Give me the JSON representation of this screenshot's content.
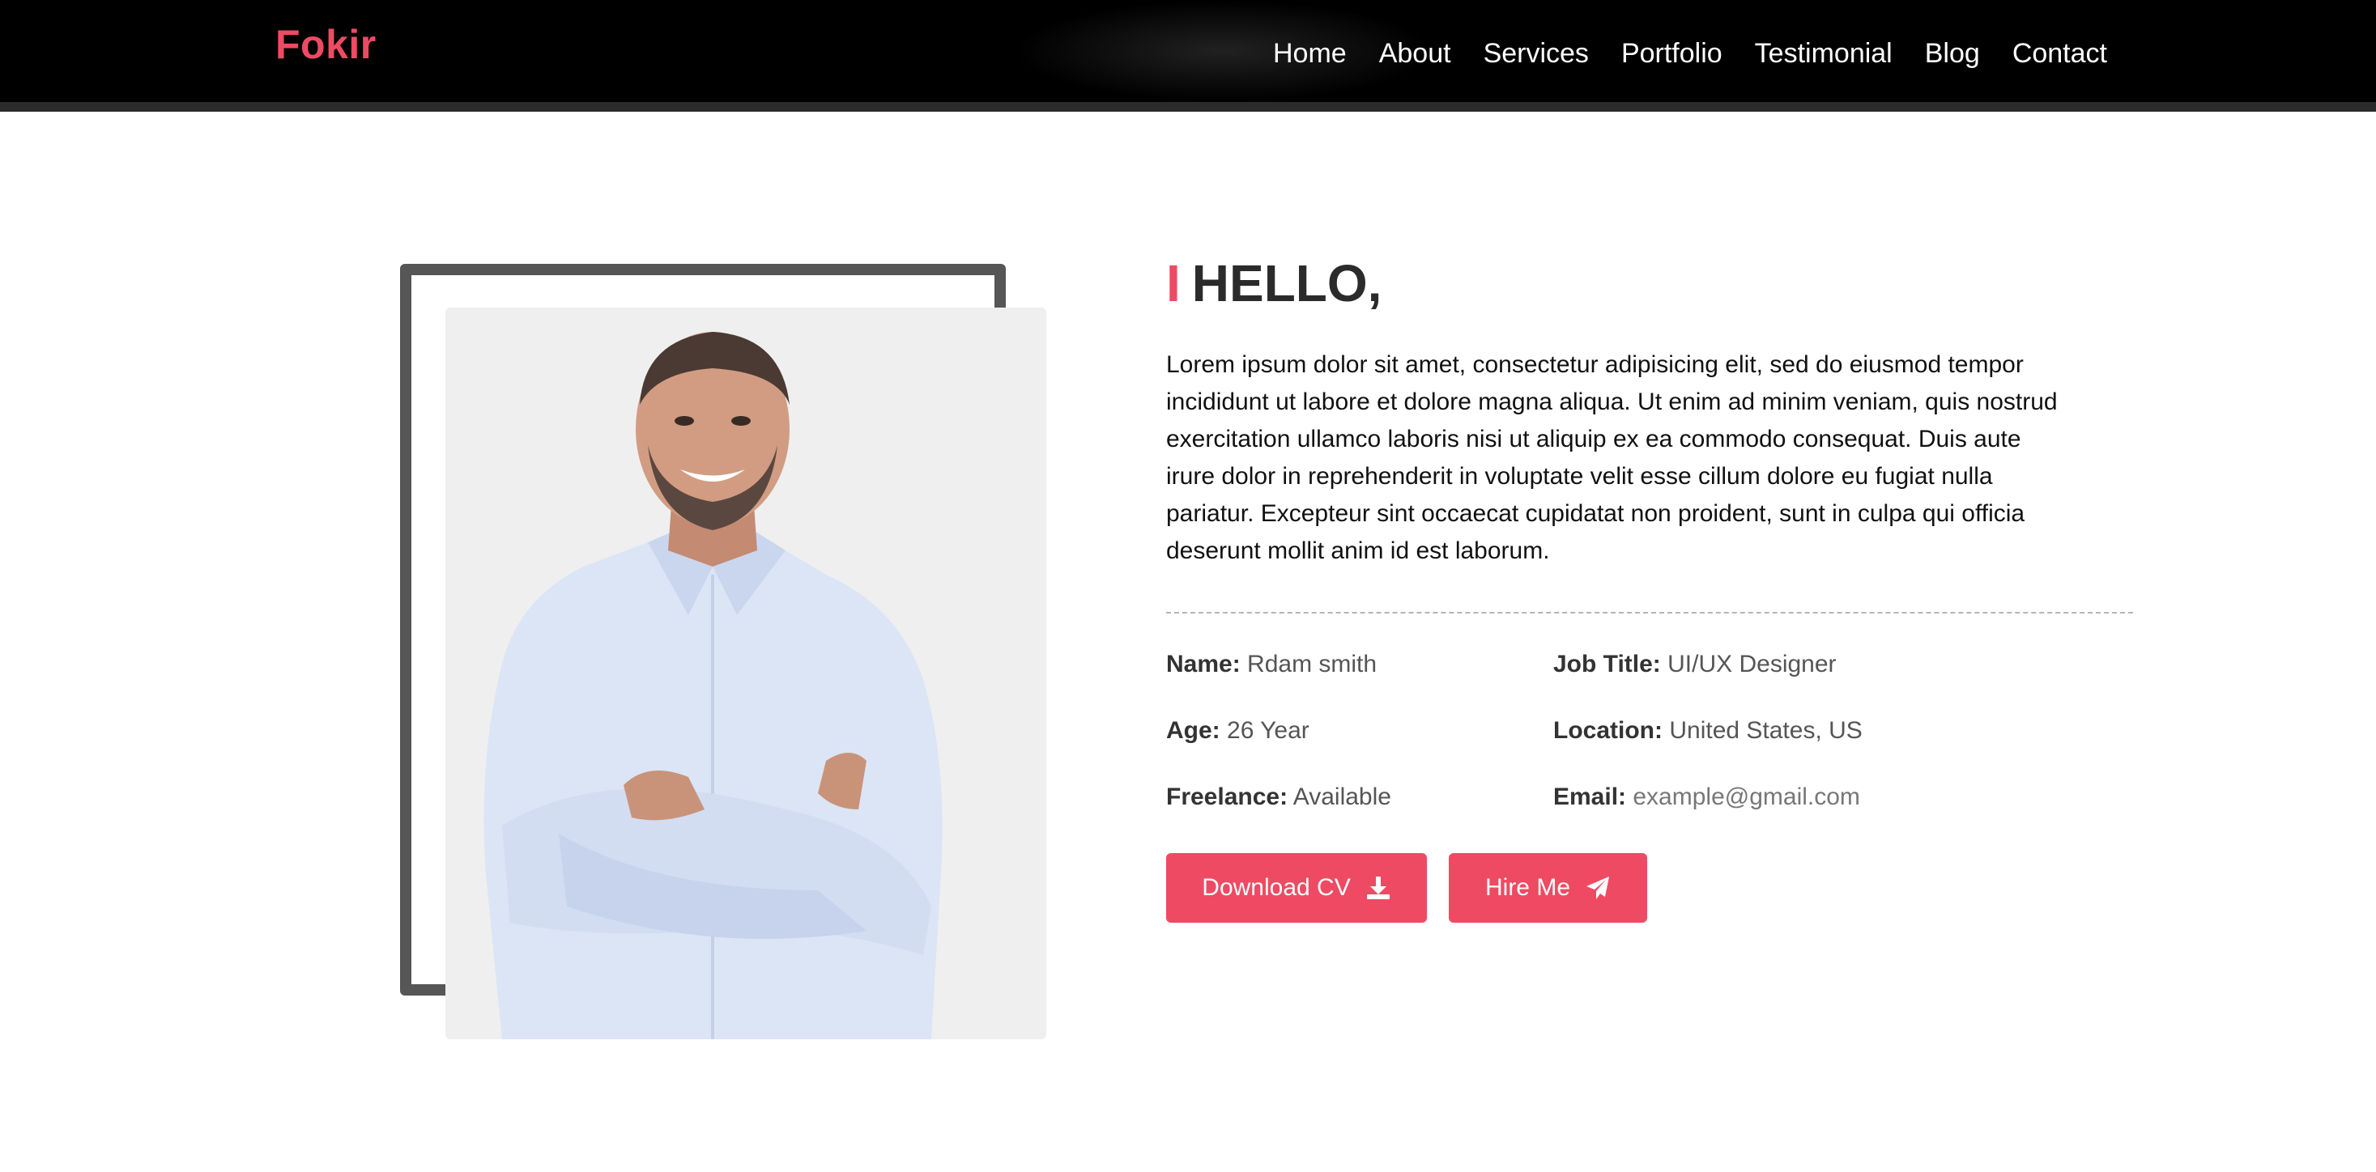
{
  "header": {
    "logo": "Fokir",
    "nav": [
      "Home",
      "About",
      "Services",
      "Portfolio",
      "Testimonial",
      "Blog",
      "Contact"
    ]
  },
  "about": {
    "heading_bar": "I",
    "heading": "HELLO,",
    "bio": "Lorem ipsum dolor sit amet, consectetur adipisicing elit, sed do eiusmod tempor incididunt ut labore et dolore magna aliqua. Ut enim ad minim veniam, quis nostrud exercitation ullamco laboris nisi ut aliquip ex ea commodo consequat. Duis aute irure dolor in reprehenderit in voluptate velit esse cillum dolore eu fugiat nulla pariatur. Excepteur sint occaecat cupidatat non proident, sunt in culpa qui officia deserunt mollit anim id est laborum.",
    "info": {
      "name_label": "Name:",
      "name": "Rdam smith",
      "job_label": "Job Title:",
      "job": "UI/UX Designer",
      "age_label": "Age:",
      "age": "26 Year",
      "location_label": "Location:",
      "location": "United States, US",
      "freelance_label": "Freelance:",
      "freelance": "Available",
      "email_label": "Email:",
      "email": "example@gmail.com"
    },
    "buttons": {
      "download": "Download CV",
      "hire": "Hire Me"
    }
  },
  "colors": {
    "accent": "#ef4a63",
    "nav_bg": "#000000",
    "frame": "#565656"
  },
  "icons": [
    "download-icon",
    "paper-plane-icon"
  ]
}
